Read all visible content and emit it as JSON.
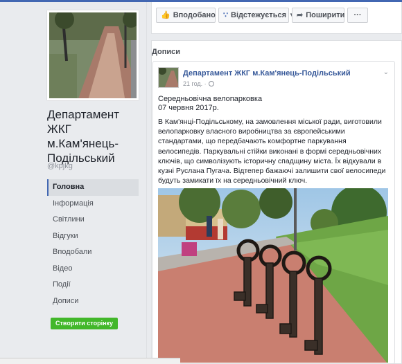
{
  "page": {
    "name": "Департамент ЖКГ м.Кам'янець-Подільський",
    "handle": "@kpjkg"
  },
  "nav": {
    "items": [
      {
        "label": "Головна",
        "active": true
      },
      {
        "label": "Інформація",
        "active": false
      },
      {
        "label": "Світлини",
        "active": false
      },
      {
        "label": "Відгуки",
        "active": false
      },
      {
        "label": "Вподобали",
        "active": false
      },
      {
        "label": "Відео",
        "active": false
      },
      {
        "label": "Події",
        "active": false
      },
      {
        "label": "Дописи",
        "active": false
      }
    ],
    "create_page_label": "Створити сторінку"
  },
  "actions": {
    "liked_label": "Вподобано",
    "follow_label": "Відстежується",
    "share_label": "Поширити",
    "more_label": "···"
  },
  "posts_section": {
    "title": "Дописи"
  },
  "post": {
    "author": "Департамент ЖКГ м.Кам'янець-Подільський",
    "time": "21 год. ·",
    "title": "Середньовічна велопарковка",
    "date": "07 червня 2017р.",
    "body": "В Кам'янці-Подільському, на замовлення міської ради, виготовили велопарковку власного виробництва за європейськими стандартами, що передбачають комфортне паркування велосипедів. Паркувальні стійки виконані в формі середньовічних ключів, що символізують історичну спадщину міста. Їх відкували в кузні Руслана Пугача. Відтепер бажаючі залишити свої велосипеди будуть замикати їх на середньовічний ключ."
  },
  "colors": {
    "brand": "#4267b2",
    "link": "#365899",
    "create_button": "#42b72a"
  }
}
